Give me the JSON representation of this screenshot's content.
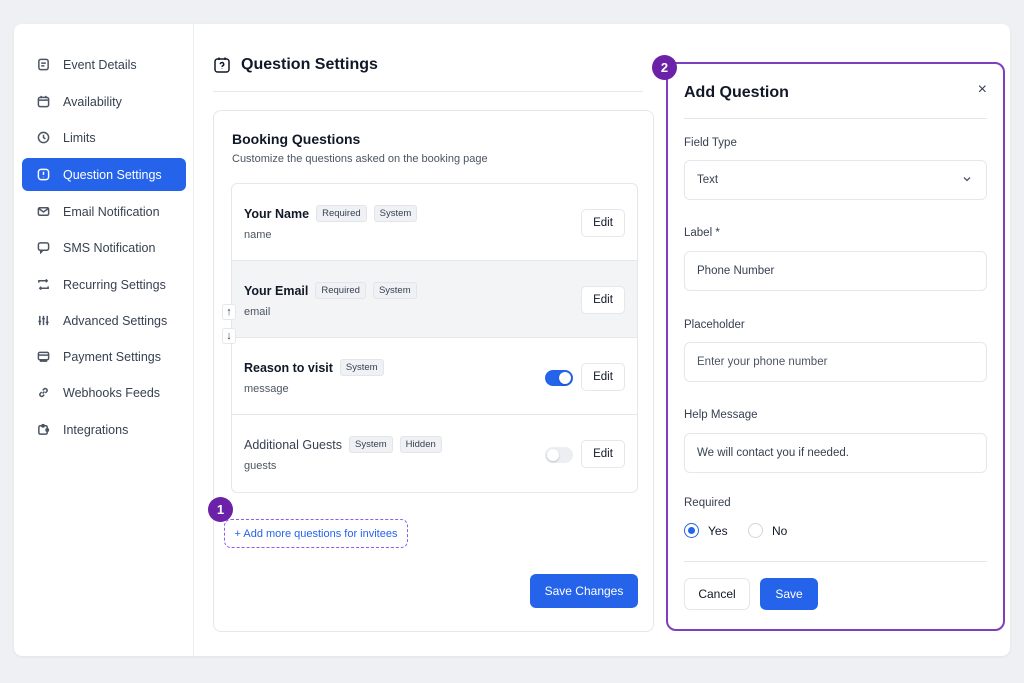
{
  "sidebar": {
    "items": [
      {
        "label": "Event Details",
        "icon": "document-icon"
      },
      {
        "label": "Availability",
        "icon": "calendar-icon"
      },
      {
        "label": "Limits",
        "icon": "clock-icon"
      },
      {
        "label": "Question Settings",
        "icon": "question-icon",
        "active": true
      },
      {
        "label": "Email Notification",
        "icon": "mail-icon"
      },
      {
        "label": "SMS Notification",
        "icon": "chat-icon"
      },
      {
        "label": "Recurring Settings",
        "icon": "repeat-icon"
      },
      {
        "label": "Advanced Settings",
        "icon": "sliders-icon"
      },
      {
        "label": "Payment Settings",
        "icon": "payment-icon"
      },
      {
        "label": "Webhooks Feeds",
        "icon": "link-icon"
      },
      {
        "label": "Integrations",
        "icon": "puzzle-icon"
      }
    ]
  },
  "page": {
    "title": "Question Settings"
  },
  "booking": {
    "title": "Booking Questions",
    "subtitle": "Customize the questions asked on the booking page",
    "questions": [
      {
        "name": "Your Name",
        "tags": [
          "Required",
          "System"
        ],
        "field": "name",
        "edit": "Edit"
      },
      {
        "name": "Your Email",
        "tags": [
          "Required",
          "System"
        ],
        "field": "email",
        "edit": "Edit"
      },
      {
        "name": "Reason to visit",
        "tags": [
          "System"
        ],
        "field": "message",
        "edit": "Edit",
        "toggle": true
      },
      {
        "name": "Additional Guests",
        "tags": [
          "System",
          "Hidden"
        ],
        "field": "guests",
        "edit": "Edit",
        "toggle": false
      }
    ],
    "move_up": "↑",
    "move_down": "↓",
    "add_more": "+ Add more questions for invitees",
    "save": "Save Changes"
  },
  "badges": {
    "one": "1",
    "two": "2"
  },
  "drawer": {
    "title": "Add Question",
    "close": "×",
    "field_type_label": "Field Type",
    "field_type_value": "Text",
    "label_label": "Label *",
    "label_value": "Phone Number",
    "placeholder_label": "Placeholder",
    "placeholder_value": "Enter your phone number",
    "help_label": "Help Message",
    "help_value": "We will contact you if needed.",
    "required_label": "Required",
    "yes": "Yes",
    "no": "No",
    "required_selected": "Yes",
    "cancel": "Cancel",
    "save": "Save"
  },
  "colors": {
    "accent": "#2563eb",
    "highlight": "#7e3fbf",
    "badge": "#6b21a8"
  }
}
